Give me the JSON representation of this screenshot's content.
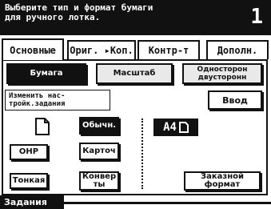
{
  "header": {
    "message": "Выберите тип и формат бумаги\nдля ручного лотка.",
    "counter": "1"
  },
  "tabs": [
    {
      "label": "Основные"
    },
    {
      "label": "Ориг. ▸Коп."
    },
    {
      "label": "Контр-т"
    },
    {
      "label": "Дополн."
    }
  ],
  "subtabs": [
    {
      "label": "Бумага"
    },
    {
      "label": "Масштаб"
    },
    {
      "label": "Односторон\nдвусторонн"
    }
  ],
  "change_settings": "Изменить нас-\nтройк.задания",
  "enter_button": "Ввод",
  "paper_types": {
    "plain": "Обычн.",
    "ohp": "OHP",
    "card": "Карточ",
    "thin": "Тонкая",
    "envelope": "Конвер\nты"
  },
  "paper_size": "A4",
  "custom_format": "Заказной\nформат",
  "footer": "Задания"
}
